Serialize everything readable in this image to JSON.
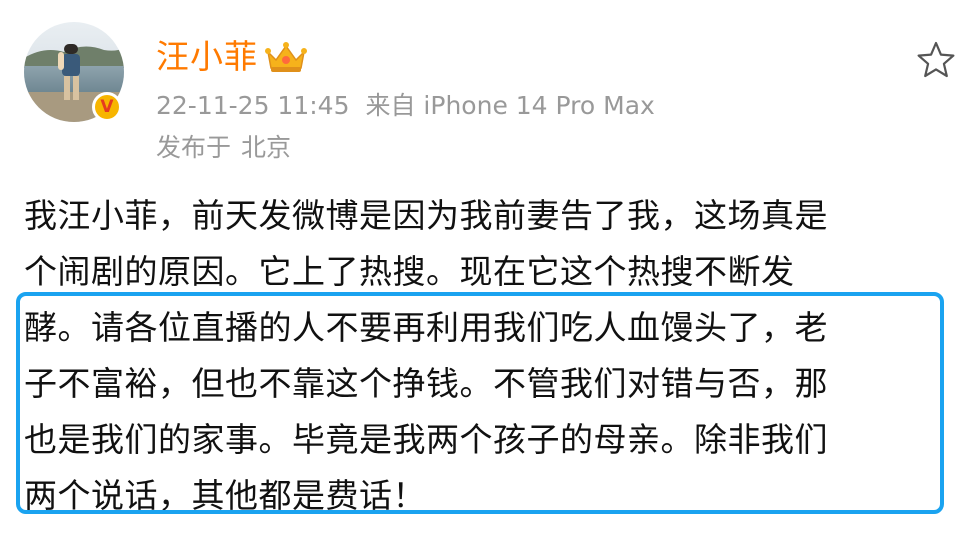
{
  "author": {
    "name": "汪小菲",
    "verified_mark": "V"
  },
  "meta": {
    "timestamp": "22-11-25 11:45",
    "source": "来自 iPhone 14 Pro Max"
  },
  "location": {
    "label": "发布于",
    "city": "北京"
  },
  "icons": {
    "favorite": "star-outline-icon",
    "badge": "crown-icon"
  },
  "colors": {
    "username": "#ff7a00",
    "meta_text": "#999999",
    "highlight_border": "#1aa3f0",
    "badge_bg": "#f7b500",
    "badge_mark": "#e53a1f"
  },
  "post": {
    "lines": [
      "我汪小菲，前天发微博是因为我前妻告了我，这场真是",
      "个闹剧的原因。它上了热搜。现在它这个热搜不断发",
      "酵。请各位直播的人不要再利用我们吃人血馒头了，老",
      "子不富裕，但也不靠这个挣钱。不管我们对错与否，那",
      "也是我们的家事。毕竟是我两个孩子的母亲。除非我们",
      "两个说话，其他都是费话！"
    ]
  }
}
